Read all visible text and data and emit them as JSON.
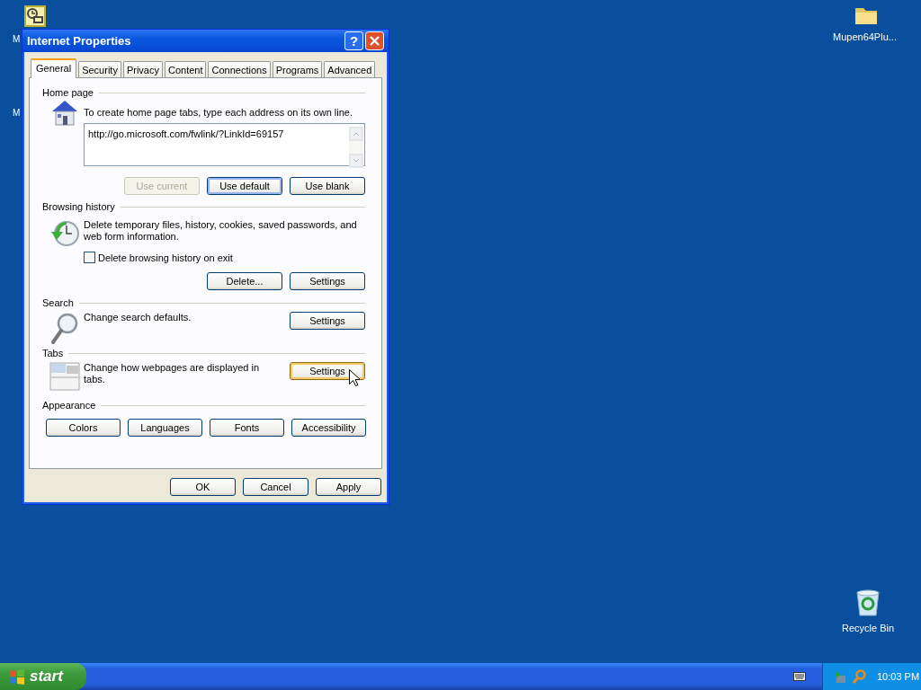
{
  "desktop": {
    "icons": [
      {
        "kind": "clock-card"
      },
      {
        "kind": "folder",
        "label": "Mupen64Plu..."
      },
      {
        "kind": "recycle-bin",
        "label": "Recycle Bin"
      }
    ],
    "label_fragments": [
      "M",
      "M"
    ]
  },
  "window": {
    "title": "Internet Properties",
    "help": "?",
    "tabs": [
      {
        "label": "General",
        "selected": true
      },
      {
        "label": "Security",
        "selected": false
      },
      {
        "label": "Privacy",
        "selected": false
      },
      {
        "label": "Content",
        "selected": false
      },
      {
        "label": "Connections",
        "selected": false
      },
      {
        "label": "Programs",
        "selected": false
      },
      {
        "label": "Advanced",
        "selected": false
      }
    ],
    "sections": [
      {
        "kind": "home",
        "title": "Home page",
        "description": "To create home page tabs, type each address on its own line.",
        "address": "http://go.microsoft.com/fwlink/?LinkId=69157",
        "buttons": [
          {
            "label": "Use current",
            "disabled": true,
            "default": false,
            "hovered": false
          },
          {
            "label": "Use default",
            "disabled": false,
            "default": true,
            "hovered": false
          },
          {
            "label": "Use blank",
            "disabled": false,
            "default": false,
            "hovered": false
          }
        ]
      },
      {
        "kind": "history",
        "title": "Browsing history",
        "description": "Delete temporary files, history, cookies, saved passwords, and web form information.",
        "checkbox": {
          "label": "Delete browsing history on exit",
          "checked": false
        },
        "buttons": [
          {
            "label": "Delete...",
            "disabled": false,
            "default": false,
            "hovered": false
          },
          {
            "label": "Settings",
            "disabled": false,
            "default": false,
            "hovered": false
          }
        ]
      },
      {
        "kind": "search",
        "title": "Search",
        "description": "Change search defaults.",
        "buttons": [
          {
            "label": "Settings",
            "disabled": false,
            "default": false,
            "hovered": false
          }
        ]
      },
      {
        "kind": "tabs",
        "title": "Tabs",
        "description": "Change how webpages are displayed in tabs.",
        "buttons": [
          {
            "label": "Settings",
            "disabled": false,
            "default": false,
            "hovered": true
          }
        ]
      },
      {
        "kind": "appearance",
        "title": "Appearance",
        "buttons": [
          {
            "label": "Colors",
            "disabled": false,
            "default": false,
            "hovered": false
          },
          {
            "label": "Languages",
            "disabled": false,
            "default": false,
            "hovered": false
          },
          {
            "label": "Fonts",
            "disabled": false,
            "default": false,
            "hovered": false
          },
          {
            "label": "Accessibility",
            "disabled": false,
            "default": false,
            "hovered": false
          }
        ]
      }
    ],
    "footer_buttons": [
      {
        "label": "OK",
        "disabled": false,
        "default": false,
        "hovered": false
      },
      {
        "label": "Cancel",
        "disabled": false,
        "default": false,
        "hovered": false
      },
      {
        "label": "Apply",
        "disabled": false,
        "default": false,
        "hovered": false
      }
    ]
  },
  "taskbar": {
    "start": "start",
    "clock": "10:03 PM"
  }
}
